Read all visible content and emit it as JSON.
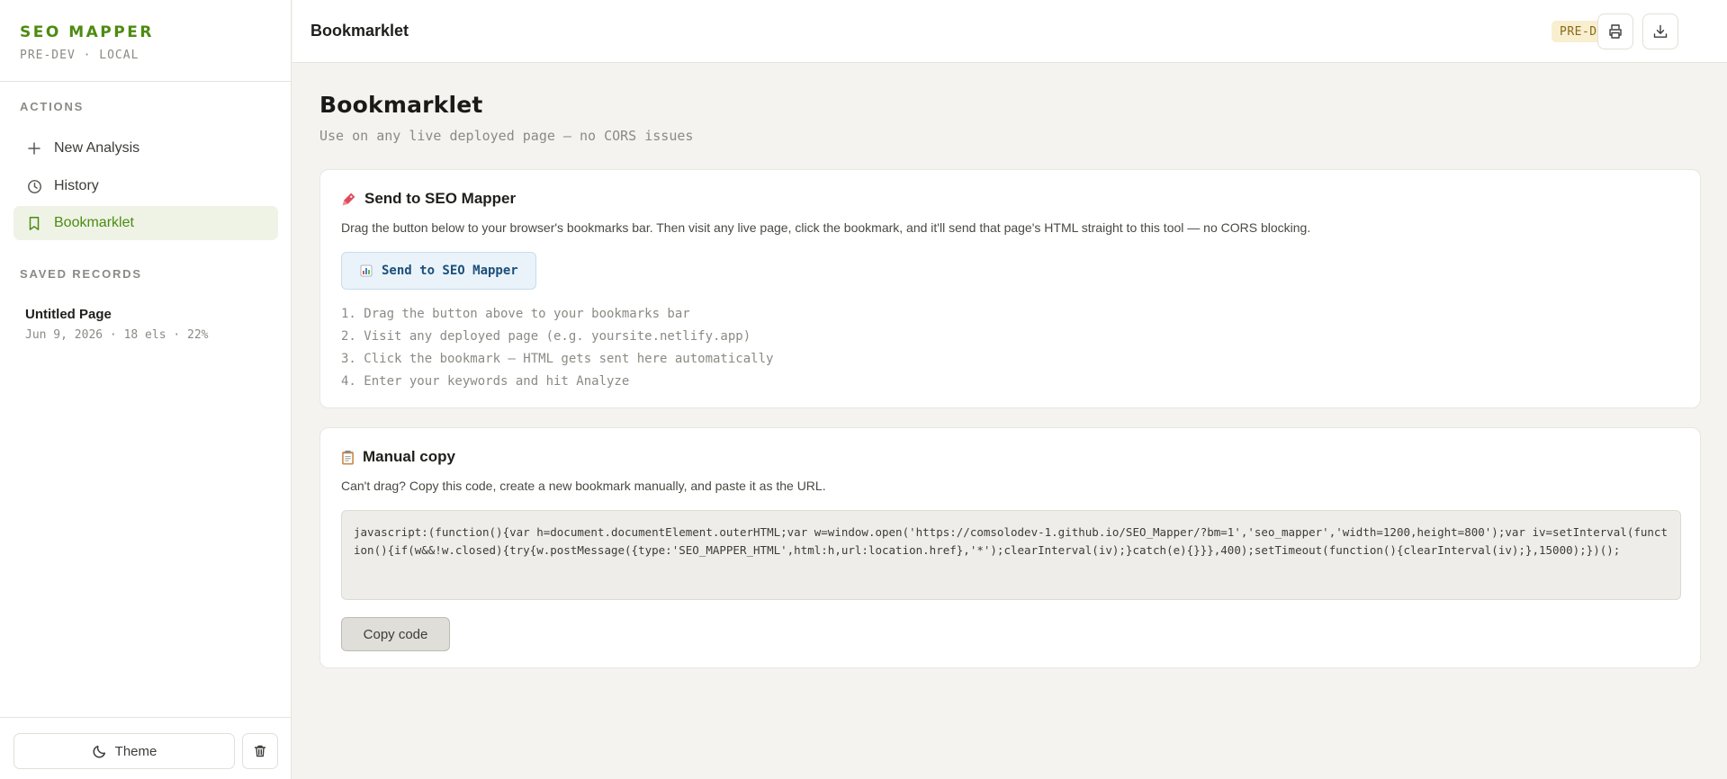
{
  "brand": {
    "title": "SEO MAPPER",
    "subtitle": "PRE-DEV · LOCAL"
  },
  "sidebar": {
    "actions_label": "ACTIONS",
    "items": [
      {
        "label": "New Analysis",
        "icon": "plus-icon"
      },
      {
        "label": "History",
        "icon": "clock-icon"
      },
      {
        "label": "Bookmarklet",
        "icon": "bookmark-icon",
        "active": true
      }
    ],
    "saved_label": "SAVED RECORDS",
    "records": [
      {
        "title": "Untitled Page",
        "meta": "Jun 9, 2026 · 18 els · 22%"
      }
    ],
    "theme_label": "Theme"
  },
  "header": {
    "title": "Bookmarklet",
    "badge": "PRE-DEV"
  },
  "main": {
    "title": "Bookmarklet",
    "subtitle": "Use on any live deployed page — no CORS issues",
    "send_card": {
      "title": "Send to SEO Mapper",
      "description": "Drag the button below to your browser's bookmarks bar. Then visit any live page, click the bookmark, and it'll send that page's HTML straight to this tool — no CORS blocking.",
      "button_label": "Send to SEO Mapper",
      "steps": [
        "1. Drag the button above to your bookmarks bar",
        "2. Visit any deployed page (e.g. yoursite.netlify.app)",
        "3. Click the bookmark — HTML gets sent here automatically",
        "4. Enter your keywords and hit Analyze"
      ]
    },
    "manual_card": {
      "title": "Manual copy",
      "description": "Can't drag? Copy this code, create a new bookmark manually, and paste it as the URL.",
      "code": "javascript:(function(){var h=document.documentElement.outerHTML;var w=window.open('https://comsolodev-1.github.io/SEO_Mapper/?bm=1','seo_mapper','width=1200,height=800');var iv=setInterval(function(){if(w&&!w.closed){try{w.postMessage({type:'SEO_MAPPER_HTML',html:h,url:location.href},'*');clearInterval(iv);}catch(e){}}},400);setTimeout(function(){clearInterval(iv);},15000);})();",
      "copy_label": "Copy code"
    }
  },
  "colors": {
    "accent": "#4e8b11",
    "active_bg": "#eef3e6",
    "badge_bg": "#f8eed0",
    "badge_text": "#8a6a16",
    "link_blue": "#1c4f7a"
  }
}
